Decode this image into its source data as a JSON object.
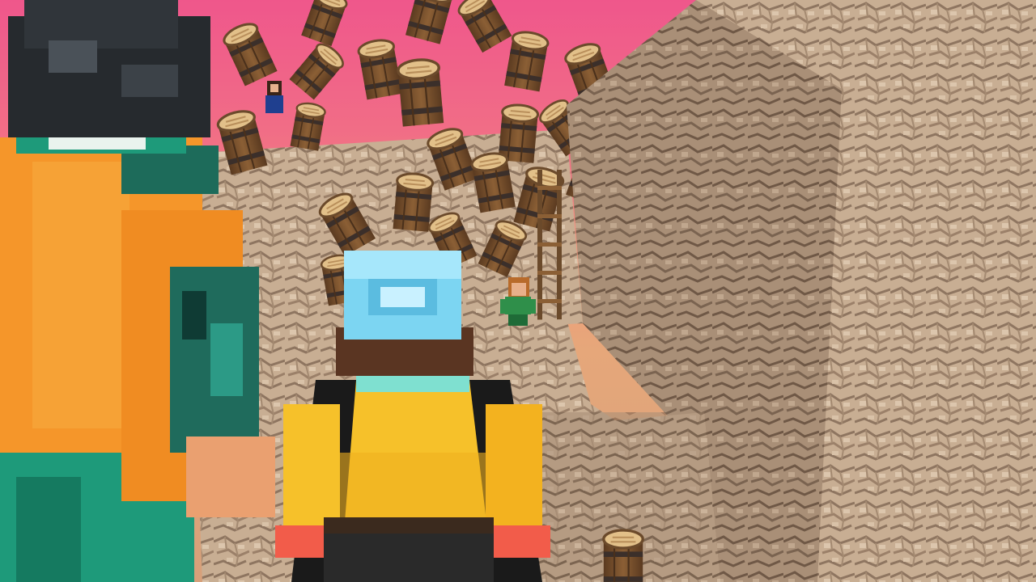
{
  "scene": {
    "kind": "voxel-game-cutscene",
    "hud_visible": false,
    "palette": {
      "sky_top": "#ee4f8d",
      "sky_bottom": "#f39a7c",
      "cobblestone": "#c8ae93",
      "cobblestone_dark": "#8e7560",
      "barrel_wood": "#7a5330",
      "barrel_lid": "#e2c089",
      "barrel_band": "#3b2f2a",
      "orange_shirt": "#f5962a",
      "yellow_shirt": "#f6c12a",
      "teal_pants": "#1e9a7a",
      "diamond_helmet": "#7cd5f2",
      "green_outfit": "#2f8f4a"
    },
    "characters": [
      {
        "name": "dark-haired-hero-back",
        "outfit": "orange-shirt-teal-pants"
      },
      {
        "name": "helmeted-hero-back",
        "outfit": "yellow-shirt-diamond-helmet"
      },
      {
        "name": "distant-green-figure",
        "outfit": "green-outfit"
      },
      {
        "name": "distant-top-figure",
        "outfit": "blue-shirt"
      }
    ],
    "objects": [
      "falling-barrels",
      "cobblestone-tower",
      "cobblestone-ledge",
      "wooden-ladder"
    ]
  }
}
